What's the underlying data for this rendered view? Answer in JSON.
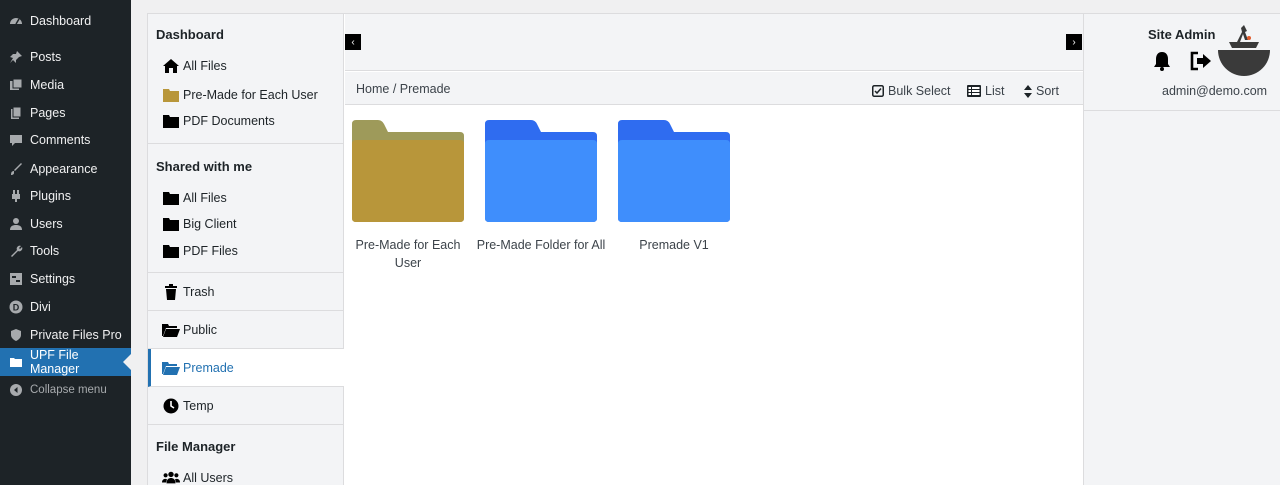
{
  "wp_menu": {
    "items": [
      {
        "label": "Dashboard",
        "icon": "dashboard-icon"
      },
      {
        "label": "Posts",
        "icon": "pin-icon"
      },
      {
        "label": "Media",
        "icon": "media-icon"
      },
      {
        "label": "Pages",
        "icon": "pages-icon"
      },
      {
        "label": "Comments",
        "icon": "comment-icon"
      },
      {
        "label": "Appearance",
        "icon": "brush-icon"
      },
      {
        "label": "Plugins",
        "icon": "plug-icon"
      },
      {
        "label": "Users",
        "icon": "user-icon"
      },
      {
        "label": "Tools",
        "icon": "wrench-icon"
      },
      {
        "label": "Settings",
        "icon": "settings-icon"
      },
      {
        "label": "Divi",
        "icon": "divi-icon"
      },
      {
        "label": "Private Files Pro",
        "icon": "shield-icon"
      },
      {
        "label": "UPF File Manager",
        "icon": "folder-icon",
        "active": true
      }
    ],
    "collapse_label": "Collapse menu"
  },
  "sidebar": {
    "dashboard": {
      "heading": "Dashboard",
      "items": [
        "All Files",
        "Pre-Made for Each User",
        "PDF Documents"
      ]
    },
    "shared": {
      "heading": "Shared with me",
      "items": [
        "All Files",
        "Big Client",
        "PDF Files"
      ]
    },
    "trash": "Trash",
    "public": "Public",
    "premade": "Premade",
    "temp": "Temp",
    "file_manager": {
      "heading": "File Manager",
      "items": [
        "All Users"
      ]
    }
  },
  "toolbar": {
    "breadcrumb": "Home / Premade",
    "bulk_select": "Bulk Select",
    "list": "List",
    "sort": "Sort"
  },
  "folders": [
    {
      "name": "Pre-Made for Each User",
      "color": "#b8963a",
      "tab_color": "#9e9a5a"
    },
    {
      "name": "Pre-Made Folder for All",
      "color": "#3f8efc",
      "tab_color": "#2f6cf0"
    },
    {
      "name": "Premade V1",
      "color": "#3f8efc",
      "tab_color": "#2f6cf0"
    }
  ],
  "user": {
    "name": "Site Admin",
    "email": "admin@demo.com"
  },
  "colors": {
    "wp_menu_bg": "#1d2327",
    "accent": "#2271b1"
  }
}
